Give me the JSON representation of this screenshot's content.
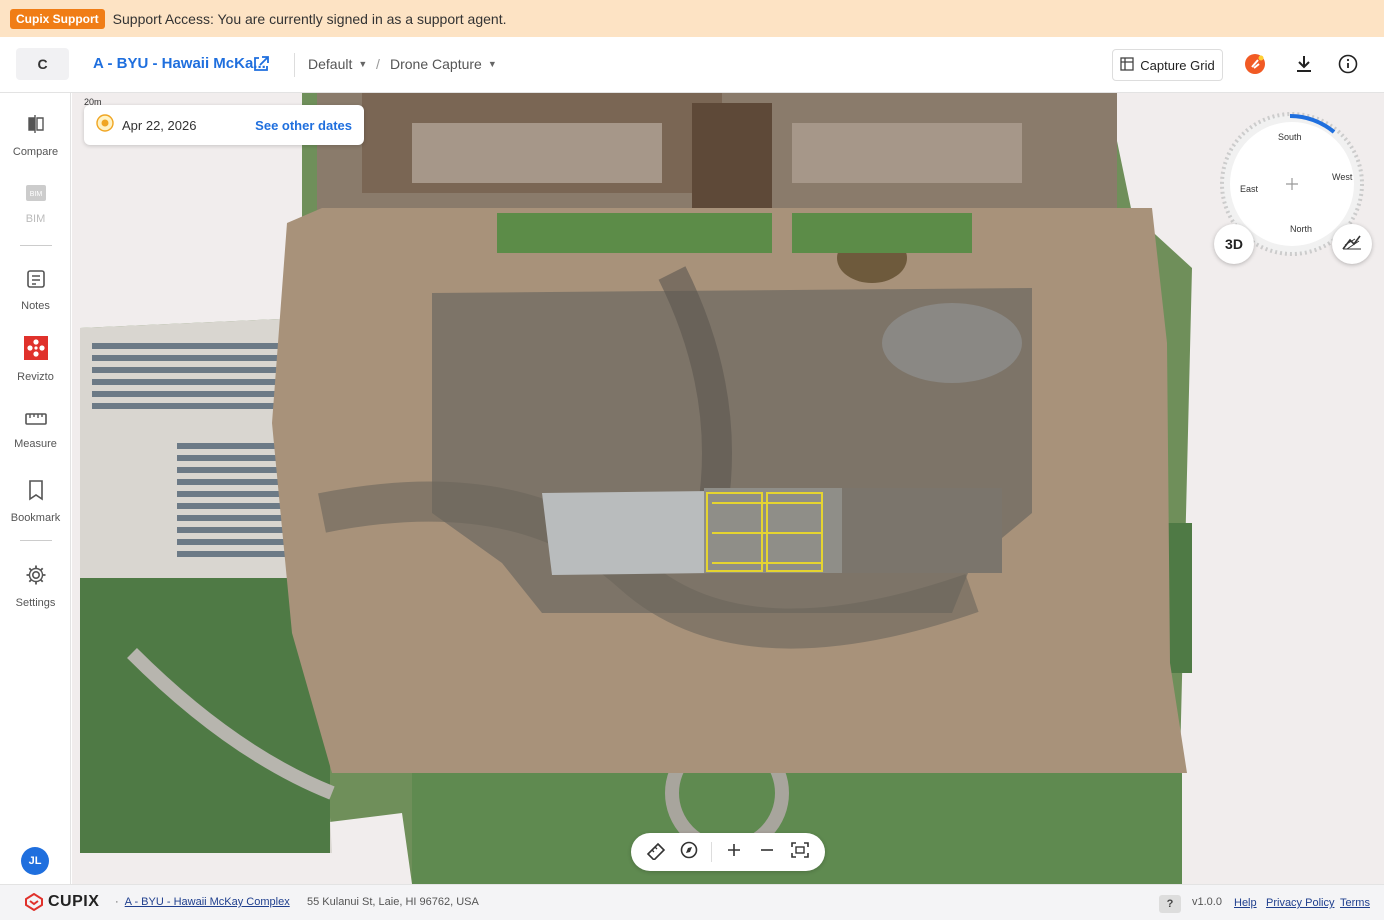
{
  "support": {
    "badge": "Cupix Support",
    "message": "Support Access: You are currently signed in as a support agent."
  },
  "header": {
    "project_initial": "C",
    "project_name": "A - BYU - Hawaii McKa...",
    "view_mode": "Default",
    "capture_type": "Drone Capture",
    "capture_grid_label": "Capture Grid"
  },
  "sidebar": {
    "items": [
      {
        "label": "Compare",
        "icon": "compare-icon"
      },
      {
        "label": "BIM",
        "icon": "bim-icon",
        "disabled": true
      },
      {
        "label": "Notes",
        "icon": "notes-icon"
      },
      {
        "label": "Revizto",
        "icon": "revizto-icon"
      },
      {
        "label": "Measure",
        "icon": "measure-icon"
      },
      {
        "label": "Bookmark",
        "icon": "bookmark-icon"
      },
      {
        "label": "Settings",
        "icon": "gear-icon"
      }
    ],
    "user_initials": "JL"
  },
  "map": {
    "scale_label": "20m",
    "date": "Apr 22, 2026",
    "see_other_dates": "See other dates",
    "compass": {
      "top": "South",
      "left": "East",
      "right": "West",
      "bottom": "North"
    },
    "btn_3d": "3D"
  },
  "footer": {
    "brand": "CUPIX",
    "project_link": "A - BYU - Hawaii McKay Complex",
    "address": "55 Kulanui St, Laie, HI 96762, USA",
    "help_glyph": "?",
    "version": "v1.0.0",
    "help": "Help",
    "privacy": "Privacy Policy",
    "terms": "Terms"
  },
  "colors": {
    "accent": "#1f6fde",
    "banner_bg": "#fde3c4",
    "badge_bg": "#f07d16",
    "revizto_red": "#e0312b"
  }
}
